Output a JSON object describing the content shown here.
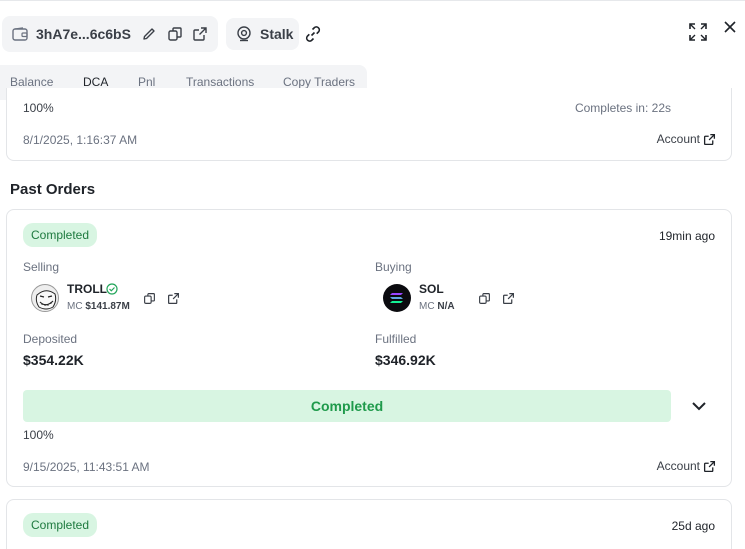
{
  "header": {
    "address": "3hA7e...6c6bS",
    "stalk_label": "Stalk"
  },
  "tabs": [
    "Balance",
    "DCA",
    "Pnl",
    "Transactions",
    "Copy Traders"
  ],
  "prev_card": {
    "percent": "100%",
    "completes_in": "Completes in: 22s",
    "date": "8/1/2025, 1:16:37 AM",
    "account_label": "Account"
  },
  "section_title": "Past Orders",
  "order": {
    "status": "Completed",
    "age": "19min ago",
    "selling_label": "Selling",
    "buying_label": "Buying",
    "sell_token": {
      "name": "TROLL",
      "mc_label": "MC",
      "mc_value": "$141.87M"
    },
    "buy_token": {
      "name": "SOL",
      "mc_label": "MC",
      "mc_value": "N/A"
    },
    "deposited_label": "Deposited",
    "deposited_value": "$354.22K",
    "fulfilled_label": "Fulfilled",
    "fulfilled_value": "$346.92K",
    "progress_label": "Completed",
    "progress_fraction": 1.0,
    "percent": "100%",
    "date": "9/15/2025, 11:43:51 AM",
    "account_label": "Account"
  },
  "next_order": {
    "status": "Completed",
    "age": "25d ago"
  },
  "colors": {
    "badge_bg": "#d8f5e2",
    "badge_text": "#1e7a3f",
    "progress_text": "#1f9a4b"
  }
}
